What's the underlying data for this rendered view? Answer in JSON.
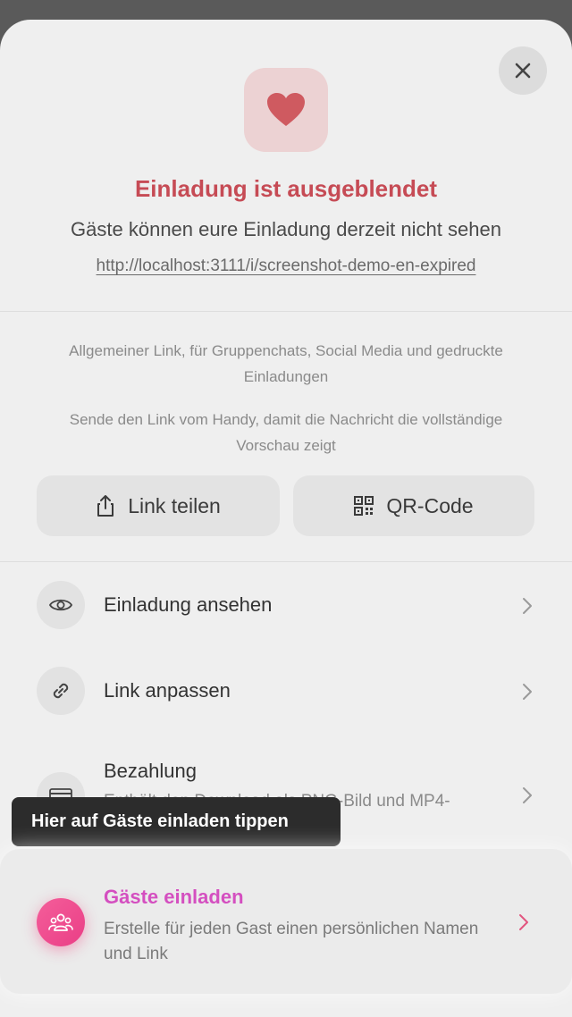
{
  "header": {
    "title": "Einladung ist ausgeblendet",
    "subtitle": "Gäste können eure Einladung derzeit nicht sehen",
    "url": "http://localhost:3111/i/screenshot-demo-en-expired"
  },
  "info": {
    "note1": "Allgemeiner Link, für Gruppenchats, Social Media und gedruckte Einladungen",
    "note2": "Sende den Link vom Handy, damit die Nachricht die vollständige Vorschau zeigt"
  },
  "actions": {
    "share_label": "Link teilen",
    "qr_label": "QR-Code"
  },
  "menu": {
    "view_label": "Einladung ansehen",
    "customize_label": "Link anpassen",
    "payment_label": "Bezahlung",
    "payment_sub": "Enthält den Download als PNG-Bild und MP4-"
  },
  "tooltip": {
    "text": "Hier auf Gäste einladen tippen"
  },
  "guests": {
    "title": "Gäste einladen",
    "description": "Erstelle für jeden Gast einen persönlichen Namen und Link"
  },
  "colors": {
    "title_red": "#c64b55",
    "guest_pink": "#d44fc0",
    "icon_gradient_start": "#f45e9a",
    "icon_gradient_end": "#ea3e86"
  }
}
